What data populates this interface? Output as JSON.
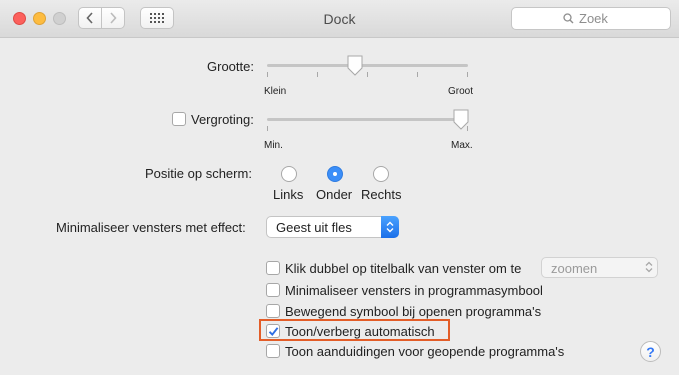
{
  "window": {
    "title": "Dock"
  },
  "toolbar": {
    "search_placeholder": "Zoek"
  },
  "size": {
    "label": "Grootte:",
    "min_label": "Klein",
    "max_label": "Groot",
    "value": 0.44
  },
  "magnification": {
    "label": "Vergroting:",
    "checked": false,
    "min_label": "Min.",
    "max_label": "Max.",
    "value": 0.97
  },
  "position": {
    "label": "Positie op scherm:",
    "options": [
      "Links",
      "Onder",
      "Rechts"
    ],
    "selected": "Onder"
  },
  "minimize_effect": {
    "label": "Minimaliseer vensters met effect:",
    "selected": "Geest uit fles"
  },
  "options": [
    {
      "label": "Klik dubbel op titelbalk van venster om te",
      "checked": false
    },
    {
      "label": "Minimaliseer vensters in programmasymbool",
      "checked": false
    },
    {
      "label": "Bewegend symbool bij openen programma's",
      "checked": false
    },
    {
      "label": "Toon/verberg automatisch",
      "checked": true
    },
    {
      "label": "Toon aanduidingen voor geopende programma's",
      "checked": false
    }
  ],
  "double_click_action": {
    "selected": "zoomen"
  },
  "help": {
    "label": "?"
  },
  "colors": {
    "accent": "#3b8ef8",
    "highlight": "#e35d28"
  }
}
